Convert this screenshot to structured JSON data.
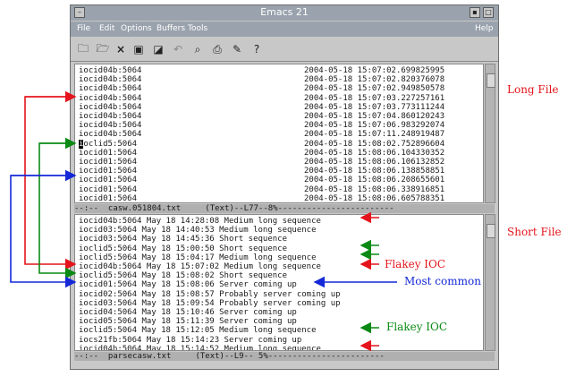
{
  "window": {
    "title": "Emacs 21"
  },
  "menubar": {
    "items": [
      "File",
      "Edit",
      "Options",
      "Buffers",
      "Tools"
    ],
    "help": "Help"
  },
  "toolbar": {
    "icons": [
      "open-folder-icon",
      "open-file-icon",
      "close-icon",
      "save-icon",
      "save-as-icon",
      "undo-icon",
      "search-icon",
      "print-icon",
      "preferences-icon",
      "help-icon"
    ]
  },
  "upper_buffer": {
    "lines": [
      {
        "host": "iocid04b:5064",
        "time": "2004-05-18 15:07:02.699825995"
      },
      {
        "host": "iocid04b:5064",
        "time": "2004-05-18 15:07:02.820376078"
      },
      {
        "host": "iocid04b:5064",
        "time": "2004-05-18 15:07:02.949850578"
      },
      {
        "host": "iocid04b:5064",
        "time": "2004-05-18 15:07:03.227257161"
      },
      {
        "host": "iocid04b:5064",
        "time": "2004-05-18 15:07:03.773111244"
      },
      {
        "host": "iocid04b:5064",
        "time": "2004-05-18 15:07:04.860120243"
      },
      {
        "host": "iocid04b:5064",
        "time": "2004-05-18 15:07:06.983292074"
      },
      {
        "host": "iocid04b:5064",
        "time": "2004-05-18 15:07:11.248919487"
      },
      {
        "host": "ioclid5:5064",
        "time": "2004-05-18 15:08:02.752896604"
      },
      {
        "host": "iocid01:5064",
        "time": "2004-05-18 15:08:06.104330352"
      },
      {
        "host": "iocid01:5064",
        "time": "2004-05-18 15:08:06.106132852"
      },
      {
        "host": "iocid01:5064",
        "time": "2004-05-18 15:08:06.138858851"
      },
      {
        "host": "iocid01:5064",
        "time": "2004-05-18 15:08:06.208655601"
      },
      {
        "host": "iocid01:5064",
        "time": "2004-05-18 15:08:06.338916851"
      },
      {
        "host": "iocid01:5064",
        "time": "2004-05-18 15:08:06.605788351"
      }
    ],
    "modeline": "--:--  casw.051804.txt     (Text)--L77--8%------------------------"
  },
  "lower_buffer": {
    "lines": [
      "iocid04b:5064 May 18 14:28:08 Medium long sequence",
      "iocid03:5064 May 18 14:40:53 Medium long sequence",
      "iocid03:5064 May 18 14:45:36 Short sequence",
      "ioclid5:5064 May 18 15:00:50 Short sequence",
      "ioclid5:5064 May 18 15:04:17 Medium long sequence",
      "iocid04b:5064 May 18 15:07:02 Medium long sequence",
      "ioclid5:5064 May 18 15:08:02 Short sequence",
      "iocid01:5064 May 18 15:08:06 Server coming up",
      "iocid02:5064 May 18 15:08:57 Probably server coming up",
      "iocid03:5064 May 18 15:09:54 Probably server coming up",
      "iocid04:5064 May 18 15:10:46 Server coming up",
      "iocid05:5064 May 18 15:11:39 Server coming up",
      "ioclid5:5064 May 18 15:12:05 Medium long sequence",
      "iocs21fb:5064 May 18 15:14:23 Server coming up",
      "iocid04b:5064 May 18 15:14:52 Medium long sequence"
    ],
    "modeline": "--:--  parsecasw.txt     (Text)--L9-- 5%------------------------"
  },
  "annotations": {
    "long_file": "Long File",
    "short_file": "Short File",
    "flakey_ioc_1": "Flakey IOC",
    "most_common": "Most common",
    "flakey_ioc_2": "Flakey IOC"
  },
  "colors": {
    "red": "#e4141c",
    "green": "#0a8a14",
    "blue": "#1428d8",
    "chrome": "#9aa3ad"
  }
}
